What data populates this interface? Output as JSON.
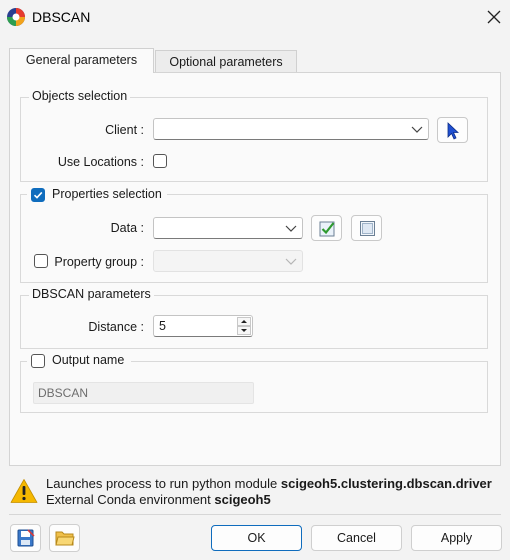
{
  "window": {
    "title": "DBSCAN"
  },
  "tabs": [
    {
      "label": "General parameters",
      "active": true
    },
    {
      "label": "Optional parameters",
      "active": false
    }
  ],
  "objects_selection": {
    "title": "Objects selection",
    "client_label": "Client :",
    "client_value": "",
    "use_locations_label": "Use Locations :",
    "use_locations_checked": false
  },
  "properties_selection": {
    "title": "Properties selection",
    "checked": true,
    "data_label": "Data :",
    "data_value": "",
    "property_group_label": "Property group :",
    "property_group_checked": false,
    "property_group_value": ""
  },
  "dbscan_parameters": {
    "title": "DBSCAN parameters",
    "distance_label": "Distance :",
    "distance_value": "5"
  },
  "output": {
    "label": "Output name",
    "checked": false,
    "value": "DBSCAN"
  },
  "info": {
    "line1_prefix": "Launches process to run python module ",
    "line1_module": "scigeoh5.clustering.dbscan.driver",
    "line2_prefix": "External Conda environment ",
    "line2_env": "scigeoh5"
  },
  "buttons": {
    "ok": "OK",
    "cancel": "Cancel",
    "apply": "Apply"
  },
  "colors": {
    "accent": "#0f6cbd",
    "warning": "#f5b800"
  }
}
